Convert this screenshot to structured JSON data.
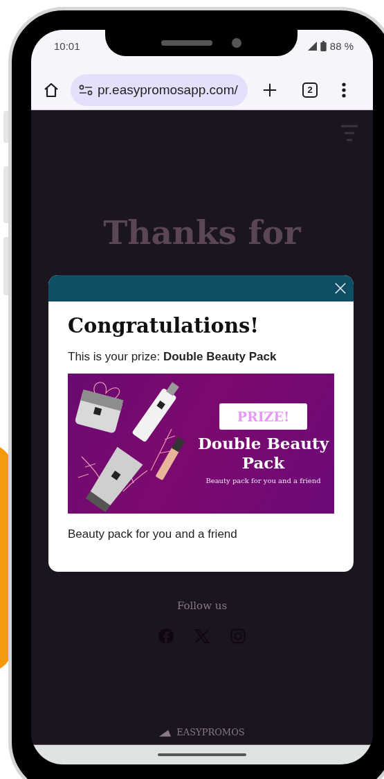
{
  "status_bar": {
    "time": "10:01",
    "battery": "88 %"
  },
  "browser": {
    "url": "pr.easypromosapp.com/",
    "tab_count": "2"
  },
  "page": {
    "heading": "Thanks for",
    "follow_label": "Follow us",
    "social": [
      {
        "kind": "facebook"
      },
      {
        "kind": "x"
      },
      {
        "kind": "instagram"
      }
    ],
    "footer_brand": "EASYPROMOS"
  },
  "modal": {
    "title": "Congratulations!",
    "prize_line": "This is your prize: **Double Beauty Pack**",
    "banner": {
      "badge": "PRIZE!",
      "title": "Double Beauty Pack",
      "subtitle": "Beauty pack for you and a friend"
    },
    "description": "Beauty pack for you and a friend"
  }
}
